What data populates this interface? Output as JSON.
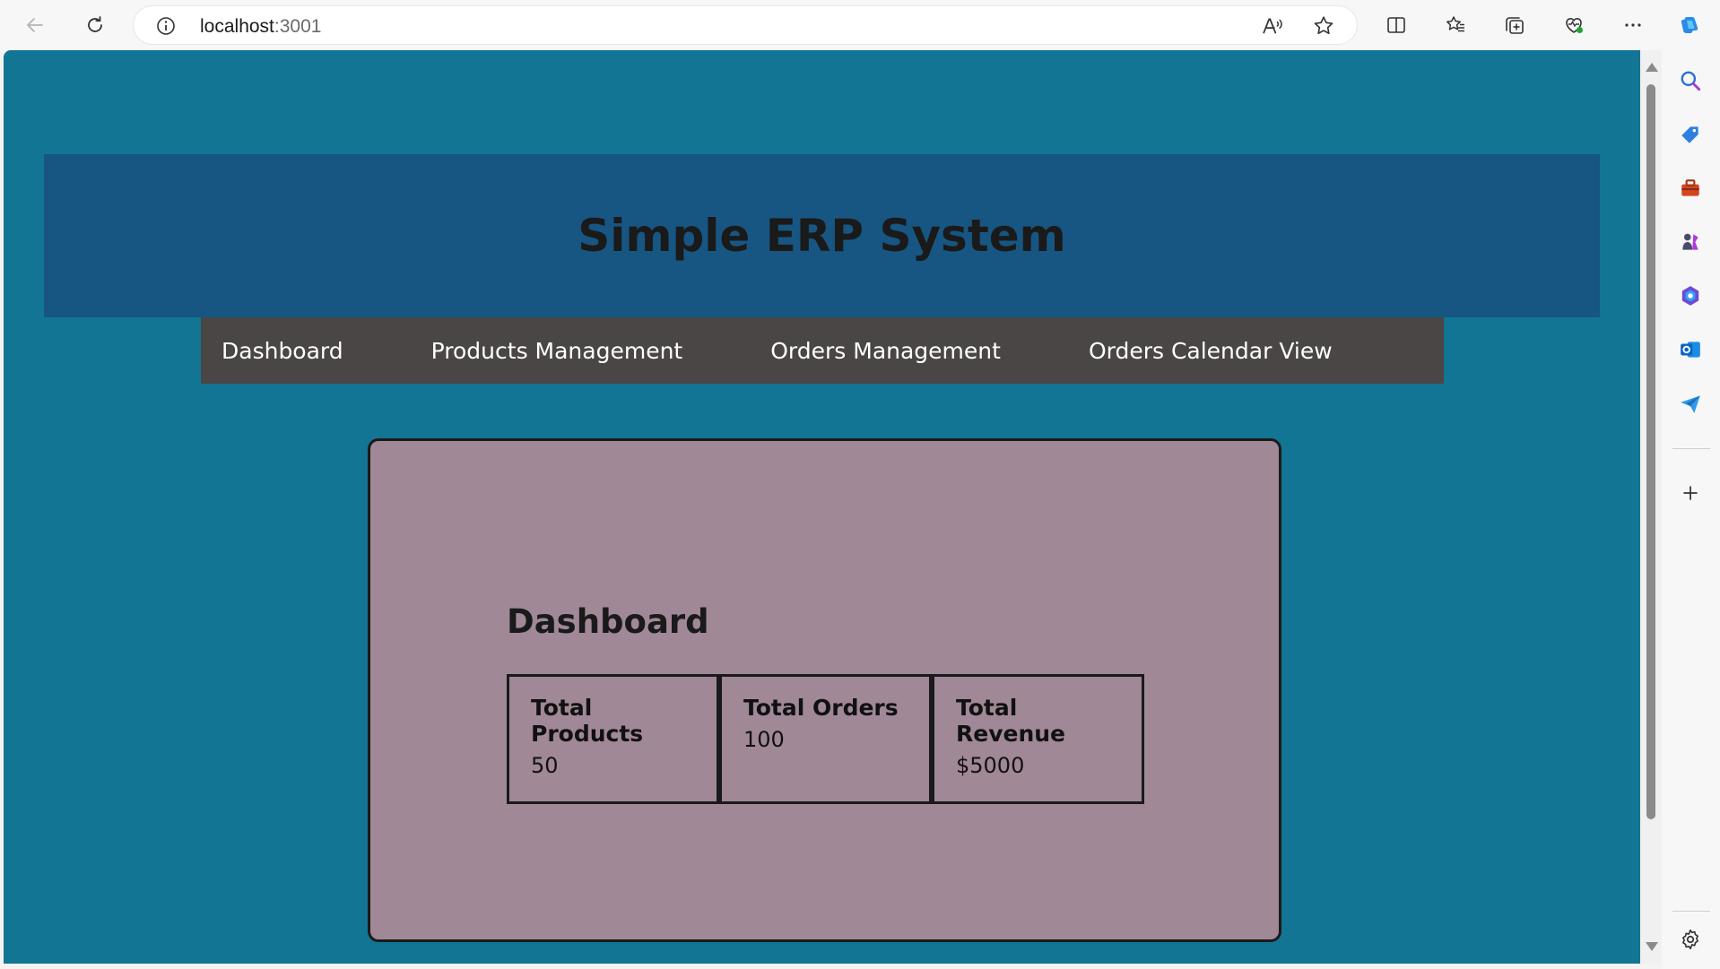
{
  "browser": {
    "url_host": "localhost",
    "url_port": ":3001",
    "icons": [
      "back-icon",
      "refresh-icon",
      "site-info-icon",
      "read-aloud-icon",
      "favorite-star-icon",
      "split-screen-icon",
      "favorites-icon",
      "collections-icon",
      "browser-essentials-icon",
      "more-icon",
      "copilot-icon"
    ]
  },
  "sidebar": {
    "icons": [
      "search-icon",
      "shopping-tag-icon",
      "tools-icon",
      "games-icon",
      "microsoft365-icon",
      "outlook-icon",
      "send-icon",
      "add-icon",
      "settings-icon"
    ]
  },
  "app": {
    "title": "Simple ERP System",
    "header_color": "#175682",
    "background_color": "#137594",
    "nav_color": "#4a4646",
    "panel_color": "#a08896",
    "nav": [
      {
        "label": "Dashboard"
      },
      {
        "label": "Products Management"
      },
      {
        "label": "Orders Management"
      },
      {
        "label": "Orders Calendar View"
      }
    ],
    "dashboard": {
      "title": "Dashboard",
      "cards": [
        {
          "label": "Total Products",
          "value": "50"
        },
        {
          "label": "Total Orders",
          "value": "100"
        },
        {
          "label": "Total Revenue",
          "value": "$5000"
        }
      ]
    }
  }
}
